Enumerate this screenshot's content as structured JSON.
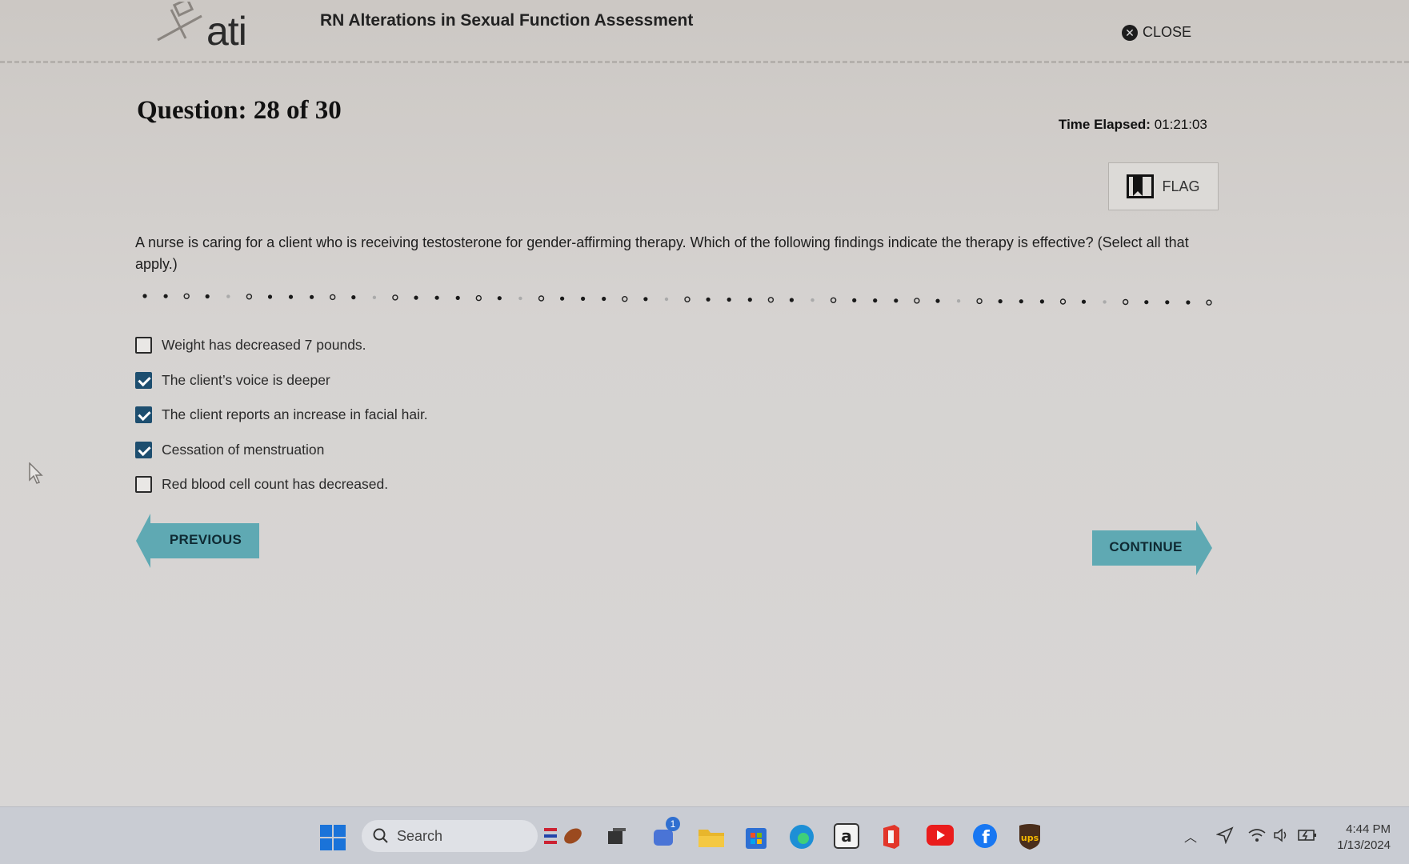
{
  "header": {
    "logo_text": "ati",
    "title": "RN Alterations in Sexual Function Assessment",
    "close_label": "CLOSE"
  },
  "question": {
    "number_label": "Question: 28 of 30",
    "timer_label": "Time Elapsed:",
    "timer_value": "01:21:03",
    "flag_label": "FLAG",
    "stem": "A nurse is caring for a client who is receiving testosterone for gender-affirming therapy. Which of the following findings indicate the therapy is effective? (Select all that apply.)",
    "options": [
      {
        "label": "Weight has decreased 7 pounds.",
        "checked": false
      },
      {
        "label": "The client’s voice is deeper",
        "checked": true
      },
      {
        "label": "The client reports an increase in facial hair.",
        "checked": true
      },
      {
        "label": "Cessation of menstruation",
        "checked": true
      },
      {
        "label": "Red blood cell count has decreased.",
        "checked": false
      }
    ]
  },
  "nav": {
    "previous_label": "PREVIOUS",
    "continue_label": "CONTINUE"
  },
  "taskbar": {
    "search_placeholder": "Search",
    "clock_time": "4:44 PM",
    "clock_date": "1/13/2024",
    "notification_count": "1"
  },
  "colors": {
    "nav_button": "#5fa9b3",
    "checkbox_checked": "#1d4e6f"
  }
}
